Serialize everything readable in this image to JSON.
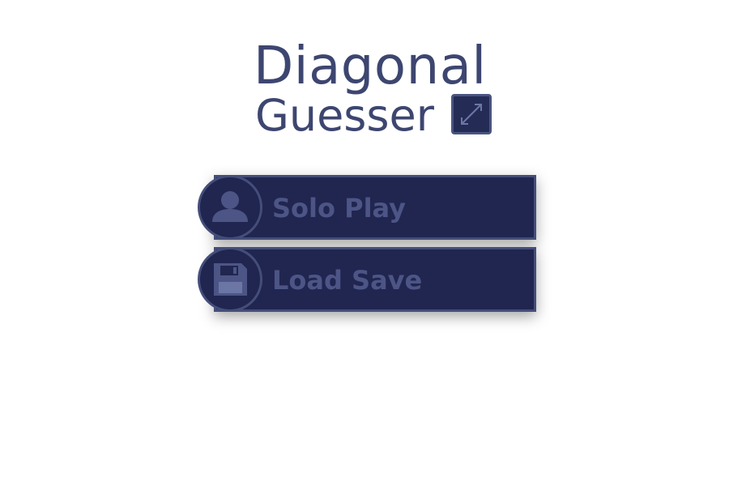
{
  "title": {
    "line1": "Diagonal",
    "line2": "Guesser",
    "badge_icon": "diagonal-arrow-icon"
  },
  "menu": {
    "items": [
      {
        "label": "Solo Play",
        "icon": "person-icon"
      },
      {
        "label": "Load Save",
        "icon": "floppy-disk-icon"
      }
    ]
  },
  "colors": {
    "title_text": "#3d4670",
    "button_fill": "#20264f",
    "button_border": "#454e7a",
    "button_label": "#4c5585",
    "background": "#ffffff"
  }
}
